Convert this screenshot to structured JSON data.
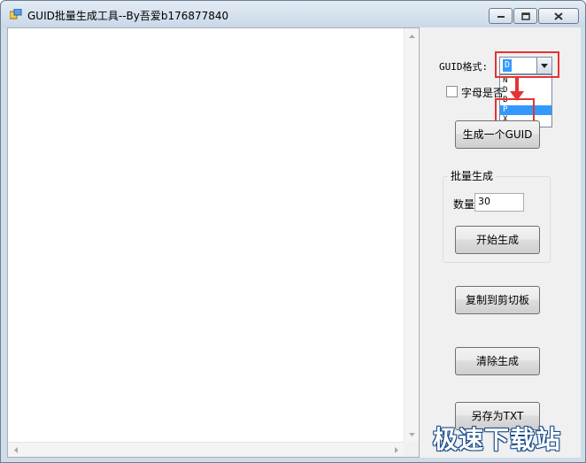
{
  "window": {
    "title": "GUID批量生成工具--By吾爱b176877840",
    "app_icon": "app-window-icon",
    "controls": [
      "minimize-icon",
      "maximize-icon",
      "close-icon"
    ]
  },
  "panel": {
    "guid_format_label": "GUID格式:",
    "guid_format_selected": "D",
    "guid_format_options": [
      "N",
      "D",
      "B",
      "P",
      "X"
    ],
    "guid_format_highlighted": "P",
    "uppercase_checkbox_label": "字母是否",
    "uppercase_checked": false,
    "generate_one_button": "生成一个GUID",
    "batch_group_title": "批量生成",
    "quantity_label": "数量",
    "quantity_value": "30",
    "start_generate_button": "开始生成",
    "copy_clipboard_button": "复制到剪切板",
    "clear_button": "清除生成",
    "save_txt_button": "另存为TXT"
  },
  "output": {
    "text": ""
  },
  "watermark": "极速下载站",
  "colors": {
    "highlight_red": "#e53333",
    "selection_blue": "#3399ff"
  }
}
